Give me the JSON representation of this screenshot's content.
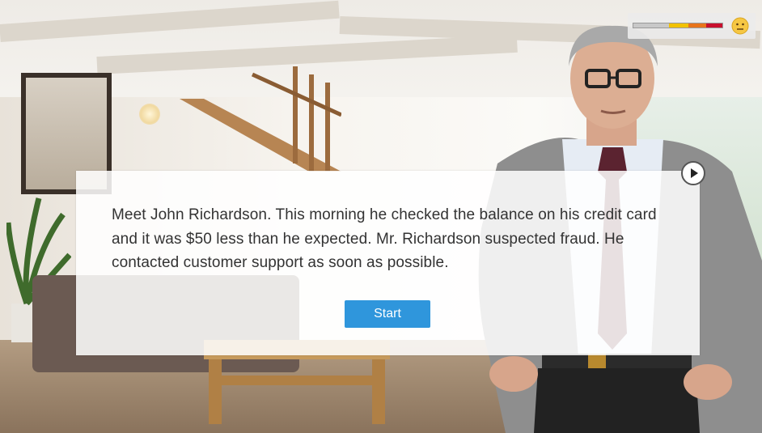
{
  "scene": {
    "dialog_text": "Meet John Richardson. This morning he checked the balance on his credit card and it was $50 less than he expected. Mr. Richardson suspected fraud. He contacted customer support as soon as possible.",
    "start_label": "Start"
  },
  "meter": {
    "level_fraction": 1.0,
    "segments": [
      {
        "color": "#f2c200",
        "from": 0.4,
        "to": 0.62
      },
      {
        "color": "#e8741b",
        "from": 0.62,
        "to": 0.82
      },
      {
        "color": "#c8102e",
        "from": 0.82,
        "to": 1.0
      }
    ],
    "mood_icon": "neutral-face-icon"
  },
  "colors": {
    "button_blue": "#2f96dc",
    "emoji_yellow": "#f6c744"
  }
}
